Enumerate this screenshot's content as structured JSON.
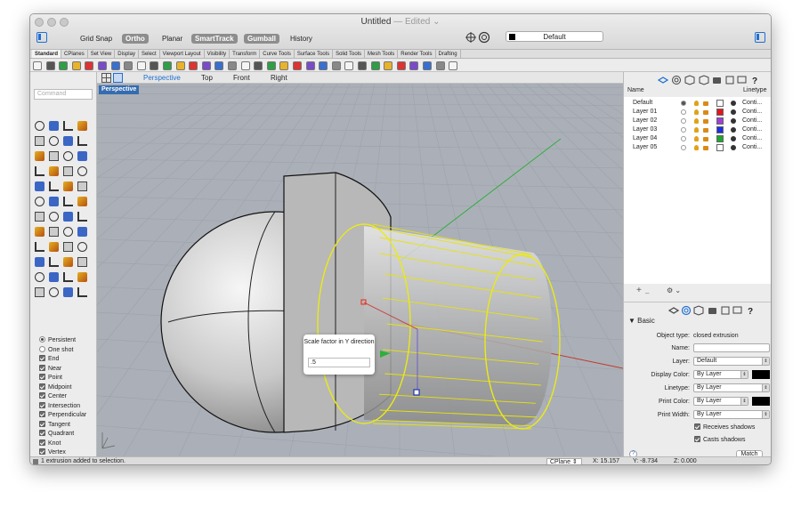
{
  "window": {
    "title": "Untitled",
    "title_state": "— Edited ⌄"
  },
  "toolbar": {
    "modes": [
      {
        "label": "Grid Snap",
        "on": false
      },
      {
        "label": "Ortho",
        "on": true
      },
      {
        "label": "Planar",
        "on": false
      },
      {
        "label": "SmartTrack",
        "on": true
      },
      {
        "label": "Gumball",
        "on": true
      },
      {
        "label": "History",
        "on": false
      }
    ],
    "current_layer": "Default"
  },
  "tabs": [
    "Standard",
    "CPlanes",
    "Set View",
    "Display",
    "Select",
    "Viewport Layout",
    "Visibility",
    "Transform",
    "Curve Tools",
    "Surface Tools",
    "Solid Tools",
    "Mesh Tools",
    "Render Tools",
    "Drafting"
  ],
  "left_panel": {
    "command_placeholder": "Command",
    "osnap_modes": [
      {
        "label": "Persistent",
        "type": "radio",
        "on": true
      },
      {
        "label": "One shot",
        "type": "radio",
        "on": false
      },
      {
        "label": "End",
        "type": "check",
        "on": true
      },
      {
        "label": "Near",
        "type": "check",
        "on": true
      },
      {
        "label": "Point",
        "type": "check",
        "on": true
      },
      {
        "label": "Midpoint",
        "type": "check",
        "on": true
      },
      {
        "label": "Center",
        "type": "check",
        "on": true
      },
      {
        "label": "Intersection",
        "type": "check",
        "on": true
      },
      {
        "label": "Perpendicular",
        "type": "check",
        "on": true
      },
      {
        "label": "Tangent",
        "type": "check",
        "on": true
      },
      {
        "label": "Quadrant",
        "type": "check",
        "on": true
      },
      {
        "label": "Knot",
        "type": "check",
        "on": true
      },
      {
        "label": "Vertex",
        "type": "check",
        "on": true
      }
    ]
  },
  "viewport_tabs": [
    "Perspective",
    "Top",
    "Front",
    "Right"
  ],
  "viewport": {
    "name": "Perspective",
    "prompt": "Scale factor in Y direction",
    "prompt_value": ".5"
  },
  "layers": {
    "col_name": "Name",
    "col_linetype": "Linetype",
    "rows": [
      {
        "name": "Default",
        "color": "#ffffff",
        "linetype": "Conti..."
      },
      {
        "name": "Layer 01",
        "color": "#e8141c",
        "linetype": "Conti..."
      },
      {
        "name": "Layer 02",
        "color": "#a040d8",
        "linetype": "Conti..."
      },
      {
        "name": "Layer 03",
        "color": "#1c2ee8",
        "linetype": "Conti..."
      },
      {
        "name": "Layer 04",
        "color": "#1ca830",
        "linetype": "Conti..."
      },
      {
        "name": "Layer 05",
        "color": "#ffffff",
        "linetype": "Conti..."
      }
    ]
  },
  "properties": {
    "section": "Basic",
    "object_type_label": "Object type:",
    "object_type_value": "closed extrusion",
    "name_label": "Name:",
    "layer_label": "Layer:",
    "layer_value": "Default",
    "display_color_label": "Display Color:",
    "display_color_value": "By Layer",
    "linetype_label": "Linetype:",
    "linetype_value": "By Layer",
    "print_color_label": "Print Color:",
    "print_color_value": "By Layer",
    "print_width_label": "Print Width:",
    "print_width_value": "By Layer",
    "receives_shadows": "Receives shadows",
    "casts_shadows": "Casts shadows",
    "match_label": "Match",
    "help_label": "?"
  },
  "status": {
    "message": "1 extrusion added to selection.",
    "cplane": "CPlane",
    "x": "X: 15.157",
    "y": "Y: -8.734",
    "z": "Z: 0.000"
  }
}
